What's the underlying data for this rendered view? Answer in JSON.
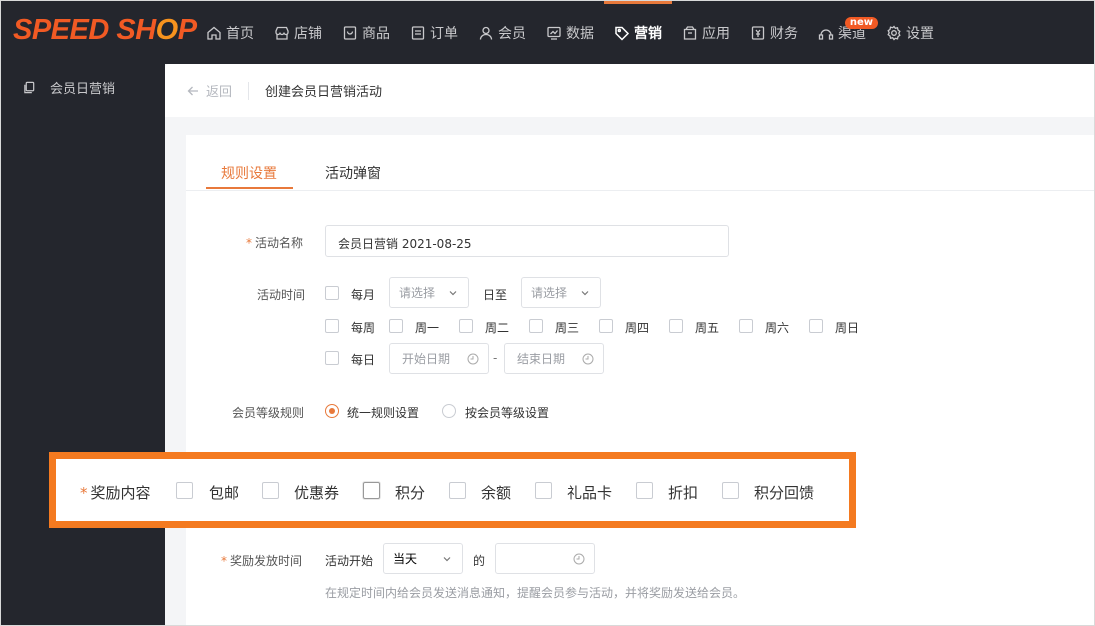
{
  "brand": {
    "logo_text_1": "SPEED SH",
    "logo_text_o": "O",
    "logo_text_2": "P"
  },
  "nav": [
    {
      "label": "首页",
      "icon": "home-icon"
    },
    {
      "label": "店铺",
      "icon": "store-icon"
    },
    {
      "label": "商品",
      "icon": "goods-icon"
    },
    {
      "label": "订单",
      "icon": "order-icon"
    },
    {
      "label": "会员",
      "icon": "user-icon"
    },
    {
      "label": "数据",
      "icon": "chart-icon"
    },
    {
      "label": "营销",
      "icon": "tag-icon",
      "active": true
    },
    {
      "label": "应用",
      "icon": "app-icon"
    },
    {
      "label": "财务",
      "icon": "finance-icon"
    },
    {
      "label": "渠道",
      "icon": "channel-icon",
      "badge": "new"
    },
    {
      "label": "设置",
      "icon": "gear-icon"
    }
  ],
  "sidebar": {
    "items": [
      {
        "label": "会员日营销",
        "icon": "copy-icon"
      }
    ]
  },
  "breadcrumb": {
    "back": "返回",
    "title": "创建会员日营销活动"
  },
  "tabs": [
    {
      "label": "规则设置",
      "active": true
    },
    {
      "label": "活动弹窗"
    }
  ],
  "form": {
    "name_label": "活动名称",
    "name_value": "会员日营销  2021-08-25",
    "time_label": "活动时间",
    "monthly": "每月",
    "select_placeholder": "请选择",
    "day_to": "日至",
    "weekly": "每周",
    "weekdays": [
      "周一",
      "周二",
      "周三",
      "周四",
      "周五",
      "周六",
      "周日"
    ],
    "daily": "每日",
    "start_date": "开始日期",
    "end_date": "结束日期",
    "date_sep": "-",
    "level_label": "会员等级规则",
    "level_options": [
      "统一规则设置",
      "按会员等级设置"
    ],
    "reward_label": "奖励内容",
    "reward_options": [
      "包邮",
      "优惠券",
      "积分",
      "余额",
      "礼品卡",
      "折扣",
      "积分回馈"
    ],
    "release_label": "奖励发放时间",
    "release_prefix": "活动开始",
    "release_select": "当天",
    "release_of": "的",
    "release_hint": "在规定时间内给会员发送消息通知，提醒会员参与活动，并将奖励发送给会员。"
  },
  "colors": {
    "accent": "#e8793b",
    "highlight": "#f47a20",
    "nav_bg": "#24262d"
  }
}
